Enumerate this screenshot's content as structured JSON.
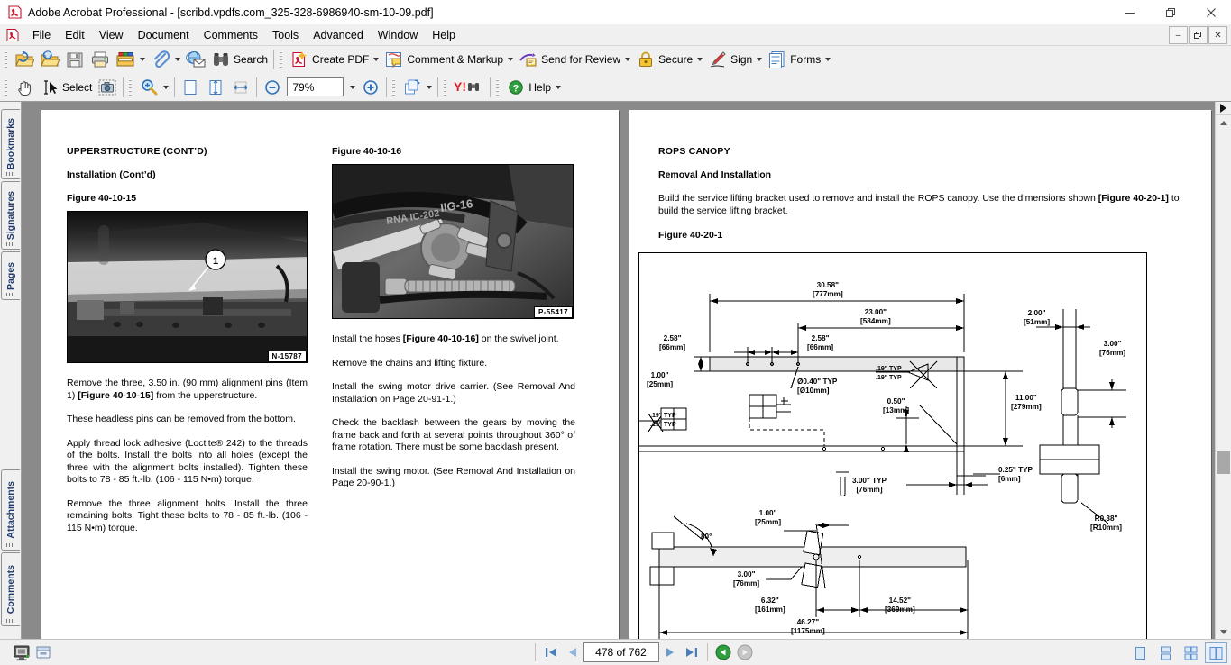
{
  "window": {
    "title": "Adobe Acrobat Professional - [scribd.vpdfs.com_325-328-6986940-sm-10-09.pdf]",
    "minimize": "—",
    "restore": "❐",
    "close": "✕",
    "doc_minimize": "–",
    "doc_restore": "❐",
    "doc_close": "✕"
  },
  "menubar": {
    "items": [
      "File",
      "Edit",
      "View",
      "Document",
      "Comments",
      "Tools",
      "Advanced",
      "Window",
      "Help"
    ]
  },
  "toolbar_top": {
    "buttons": [
      {
        "name": "open-button",
        "label": "",
        "icon": "open-folder-icon",
        "caret": false
      },
      {
        "name": "organizer-button",
        "label": "",
        "icon": "organizer-icon",
        "caret": false
      },
      {
        "name": "save-button",
        "label": "",
        "icon": "floppy-save-icon",
        "caret": false
      },
      {
        "name": "print-button",
        "label": "",
        "icon": "printer-icon",
        "caret": false
      },
      {
        "name": "email-button",
        "label": "",
        "icon": "package-icon",
        "caret": true
      },
      {
        "name": "attach-button",
        "label": "",
        "icon": "paperclip-icon",
        "caret": true
      },
      {
        "name": "send-email-button",
        "label": "",
        "icon": "globe-mail-icon",
        "caret": false
      },
      {
        "name": "search-button",
        "label": "Search",
        "icon": "binoculars-icon",
        "caret": false
      }
    ],
    "task_buttons": [
      {
        "name": "create-pdf-button",
        "label": "Create PDF",
        "icon": "create-pdf-icon",
        "caret": true
      },
      {
        "name": "comment-markup-button",
        "label": "Comment & Markup",
        "icon": "comment-markup-icon",
        "caret": true
      },
      {
        "name": "send-for-review-button",
        "label": "Send for Review",
        "icon": "send-review-icon",
        "caret": true
      },
      {
        "name": "secure-button",
        "label": "Secure",
        "icon": "padlock-icon",
        "caret": true
      },
      {
        "name": "sign-button",
        "label": "Sign",
        "icon": "pen-icon",
        "caret": true
      },
      {
        "name": "forms-button",
        "label": "Forms",
        "icon": "forms-icon",
        "caret": true
      }
    ]
  },
  "toolbar_second": {
    "hand_tool": {
      "name": "hand-tool-button",
      "icon": "hand-icon"
    },
    "select_tool": {
      "name": "select-tool-button",
      "label": "Select",
      "icon": "text-select-icon"
    },
    "snapshot_tool": {
      "name": "snapshot-tool-button",
      "icon": "camera-icon"
    },
    "zoom_in_tool": {
      "name": "zoom-tool-button",
      "icon": "magnifier-plus-icon",
      "caret": true
    },
    "actual_size": {
      "name": "actual-size-button",
      "icon": "page-icon"
    },
    "fit_page": {
      "name": "fit-page-button",
      "icon": "fit-height-icon"
    },
    "fit_width": {
      "name": "fit-width-button",
      "icon": "fit-width-icon"
    },
    "zoom_out": {
      "name": "zoom-out-button",
      "icon": "minus-circle-icon"
    },
    "zoom_value": "79%",
    "zoom_caret": {
      "name": "zoom-dropdown-button",
      "icon": "chevron-down-icon"
    },
    "zoom_in": {
      "name": "zoom-in-button",
      "icon": "plus-circle-icon"
    },
    "rotate": {
      "name": "rotate-view-button",
      "icon": "rotate-page-icon",
      "caret": true
    },
    "yahoo": {
      "name": "yahoo-search-button",
      "label": "Y!",
      "icon": "yahoo-icon"
    },
    "help": {
      "name": "help-button",
      "label": "Help",
      "icon": "help-circle-icon",
      "caret": true
    }
  },
  "nav_tabs": [
    {
      "name": "sidebar-tab-bookmarks",
      "label": "Bookmarks"
    },
    {
      "name": "sidebar-tab-signatures",
      "label": "Signatures"
    },
    {
      "name": "sidebar-tab-pages",
      "label": "Pages"
    },
    {
      "name": "sidebar-tab-attachments",
      "label": "Attachments"
    },
    {
      "name": "sidebar-tab-comments",
      "label": "Comments"
    }
  ],
  "statusbar": {
    "first_page": "◀|",
    "prev_page": "◀",
    "page_indicator": "478 of 762",
    "next_page": "▶",
    "last_page": "|▶",
    "previous_view": "back-arrow",
    "next_view": "forward-arrow",
    "view_modes": [
      {
        "name": "single-page-view-button",
        "icon": "single-page-icon",
        "active": false
      },
      {
        "name": "continuous-view-button",
        "icon": "continuous-page-icon",
        "active": false
      },
      {
        "name": "facing-continuous-view-button",
        "icon": "continuous-facing-icon",
        "active": false
      },
      {
        "name": "facing-view-button",
        "icon": "facing-page-icon",
        "active": true
      }
    ],
    "left_icons": [
      {
        "name": "security-status-icon"
      },
      {
        "name": "signature-status-icon"
      }
    ]
  },
  "page_left": {
    "heading": "UPPERSTRUCTURE (CONT’D)",
    "subheading": "Installation (Cont’d)",
    "figure_label": "Figure 40-10-15",
    "photo_tag": "N-15787",
    "callout_number": "1",
    "paragraphs": [
      {
        "pre": "Remove the three, 3.50 in. (90 mm) alignment pins (Item 1) ",
        "bold": "[Figure 40-10-15]",
        "post": " from the upperstructure."
      },
      {
        "pre": "These headless pins can be removed from the bottom.",
        "bold": "",
        "post": ""
      },
      {
        "pre": "Apply thread lock adhesive (Loctite® 242) to the threads of the bolts. Install the bolts into all holes (except the three with the alignment bolts installed). Tighten these bolts to 78 - 85 ft.-lb. (106 - 115 N•m) torque.",
        "bold": "",
        "post": ""
      },
      {
        "pre": "Remove the three alignment bolts. Install the three remaining bolts. Tight these bolts to 78 - 85 ft.-lb. (106 - 115 N•m) torque.",
        "bold": "",
        "post": ""
      }
    ],
    "col2_figure_label": "Figure 40-10-16",
    "col2_photo_tag": "P-55417",
    "col2_paragraphs": [
      {
        "pre": "Install the hoses ",
        "bold": "[Figure 40-10-16]",
        "post": " on the swivel joint."
      },
      {
        "pre": "Remove the chains and lifting fixture.",
        "bold": "",
        "post": ""
      },
      {
        "pre": "Install the swing motor drive carrier. (See Removal And Installation on Page 20-91-1.)",
        "bold": "",
        "post": ""
      },
      {
        "pre": "Check the backlash between the gears by moving the frame back and forth at several points throughout 360° of frame rotation. There must be some backlash present.",
        "bold": "",
        "post": ""
      },
      {
        "pre": "Install the swing motor. (See Removal And Installation on Page 20-90-1.)",
        "bold": "",
        "post": ""
      }
    ]
  },
  "page_right": {
    "heading": "ROPS CANOPY",
    "subheading": "Removal And Installation",
    "body_pre": "Build the service lifting bracket used to remove and install the ROPS canopy. Use the dimensions shown ",
    "body_bold": "[Figure 40-20-1]",
    "body_post": " to build the service lifting bracket.",
    "figure_label": "Figure 40-20-1",
    "drawing_dimensions": [
      {
        "name": "dim-30-58",
        "value": "30.58\"",
        "metric": "[777mm]"
      },
      {
        "name": "dim-23-00",
        "value": "23.00\"",
        "metric": "[584mm]"
      },
      {
        "name": "dim-2-58-left",
        "value": "2.58\"",
        "metric": "[66mm]"
      },
      {
        "name": "dim-2-58-right",
        "value": "2.58\"",
        "metric": "[66mm]"
      },
      {
        "name": "dim-1-00-left",
        "value": "1.00\"",
        "metric": "[25mm]"
      },
      {
        "name": "dim-hole-dia",
        "value": "Ø0.40\" TYP",
        "metric": "[Ø10mm]"
      },
      {
        "name": "dim-weld-19-a",
        "value": ".19\" TYP",
        "metric": ".19\" TYP"
      },
      {
        "name": "dim-weld-19-b",
        "value": ".19\" TYP",
        "metric": ".19\" TYP"
      },
      {
        "name": "dim-0-50",
        "value": "0.50\"",
        "metric": "[13mm]"
      },
      {
        "name": "dim-11-00",
        "value": "11.00\"",
        "metric": "[279mm]"
      },
      {
        "name": "dim-0-25-typ",
        "value": "0.25\" TYP",
        "metric": "[6mm]"
      },
      {
        "name": "dim-3-00-typ",
        "value": "3.00\" TYP",
        "metric": "[76mm]"
      },
      {
        "name": "dim-2-00",
        "value": "2.00\"",
        "metric": "[51mm]"
      },
      {
        "name": "dim-3-00-right",
        "value": "3.00\"",
        "metric": "[76mm]"
      },
      {
        "name": "dim-r0-38",
        "value": "R0.38\"",
        "metric": "[R10mm]"
      },
      {
        "name": "dim-angle-80",
        "value": "80°",
        "metric": ""
      },
      {
        "name": "dim-1-00-lower",
        "value": "1.00\"",
        "metric": "[25mm]"
      },
      {
        "name": "dim-3-00-lower",
        "value": "3.00\"",
        "metric": "[76mm]"
      },
      {
        "name": "dim-6-32",
        "value": "6.32\"",
        "metric": "[161mm]"
      },
      {
        "name": "dim-14-52",
        "value": "14.52\"",
        "metric": "[369mm]"
      },
      {
        "name": "dim-46-27",
        "value": "46.27\"",
        "metric": "[1175mm]"
      }
    ]
  },
  "colors": {
    "chrome": "#f0f0f0",
    "viewport_gray": "#8a8a8a",
    "page_white": "#ffffff",
    "tab_text": "#1e3a6e",
    "accent_blue": "#4a7ebb"
  }
}
